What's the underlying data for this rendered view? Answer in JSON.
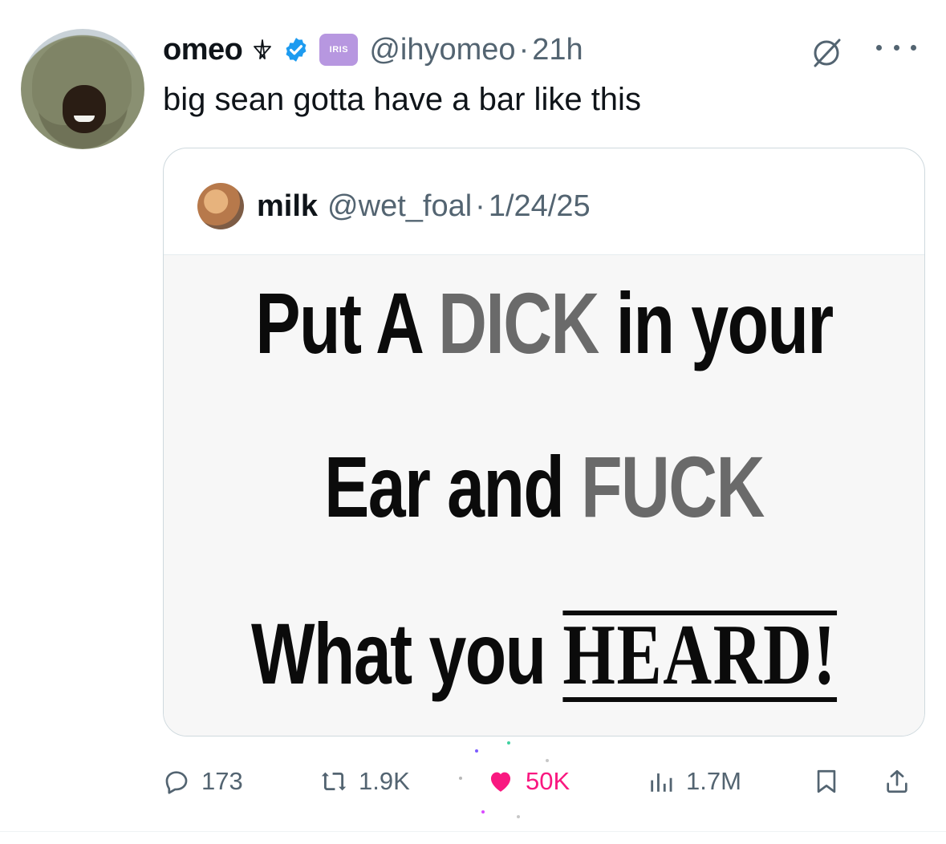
{
  "tweet": {
    "author_name": "omeo",
    "author_handle": "@ihyomeo",
    "separator": "·",
    "time": "21h",
    "badge_label": "IRIS",
    "text": "big sean gotta have a bar like this"
  },
  "quote": {
    "author_name": "milk",
    "author_handle": "@wet_foal",
    "separator": "·",
    "date": "1/24/25",
    "image_text": {
      "line1_part1": "Put A ",
      "line1_grey": "DICK",
      "line1_part2": " in your",
      "line2_part1": "Ear and ",
      "line2_grey": "FUCK",
      "line3_part1": "What you ",
      "line3_heard": "HEARD!"
    }
  },
  "actions": {
    "replies": "173",
    "reposts": "1.9K",
    "likes": "50K",
    "views": "1.7M"
  },
  "colors": {
    "text": "#0f1419",
    "secondary": "#536471",
    "verified": "#1d9bf0",
    "like": "#f91880",
    "iris_badge": "#b797e0",
    "border": "#cfd9de"
  },
  "icons": [
    "pentagram-icon",
    "verified-icon",
    "grok-icon",
    "more-icon",
    "reply-icon",
    "repost-icon",
    "heart-icon",
    "views-icon",
    "bookmark-icon",
    "share-icon"
  ]
}
